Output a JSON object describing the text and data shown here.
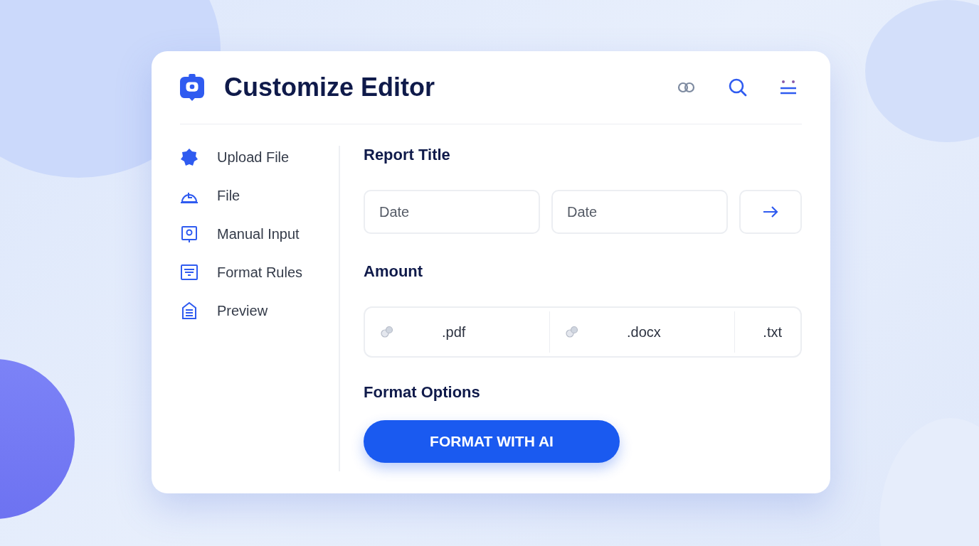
{
  "header": {
    "title": "Customize Editor"
  },
  "sidebar": {
    "items": [
      {
        "label": "Upload File"
      },
      {
        "label": "File"
      },
      {
        "label": "Manual Input"
      },
      {
        "label": "Format Rules"
      },
      {
        "label": "Preview"
      }
    ]
  },
  "report_title": {
    "heading": "Report Title",
    "fields": [
      {
        "placeholder": "Date"
      },
      {
        "placeholder": "Date"
      }
    ]
  },
  "amount": {
    "heading": "Amount",
    "formats": [
      {
        "kind": "icon",
        "label": ".pdf"
      },
      {
        "kind": "icon",
        "label": ".docx"
      },
      {
        "kind": "plain",
        "label": ".txt"
      }
    ]
  },
  "format_options": {
    "heading": "Format Options",
    "button": "FORMAT WITH AI"
  }
}
